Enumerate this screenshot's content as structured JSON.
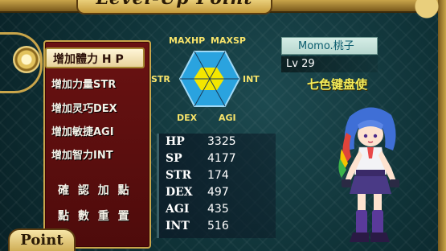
{
  "window": {
    "title": "Level-Up Point"
  },
  "menu": {
    "selected_label": "增加體力 H P",
    "items": [
      "增加力量STR",
      "增加灵巧DEX",
      "增加敏捷AGI",
      "增加智力INT"
    ],
    "confirm_label": "確 認 加 點",
    "reset_label": "點 數 重 置"
  },
  "point_plate": "Point",
  "radar": {
    "labels": {
      "maxhp": "MAXHP",
      "maxsp": "MAXSP",
      "str": "STR",
      "int": "INT",
      "dex": "DEX",
      "agi": "AGI"
    },
    "colors": {
      "chart_fill": "#2aa3df",
      "stat_fill": "#f3e600"
    }
  },
  "stats": [
    {
      "label": "HP",
      "value": "3325"
    },
    {
      "label": "SP",
      "value": "4177"
    },
    {
      "label": "STR",
      "value": "174"
    },
    {
      "label": "DEX",
      "value": "497"
    },
    {
      "label": "AGI",
      "value": "435"
    },
    {
      "label": "INT",
      "value": "516"
    }
  ],
  "character": {
    "name": "Momo.桃子",
    "level": "Lv 29",
    "title": "七色键盘使"
  },
  "colors": {
    "panel_red": "#5c0f0f",
    "gold": "#c9a54a",
    "background": "#0f3237"
  }
}
